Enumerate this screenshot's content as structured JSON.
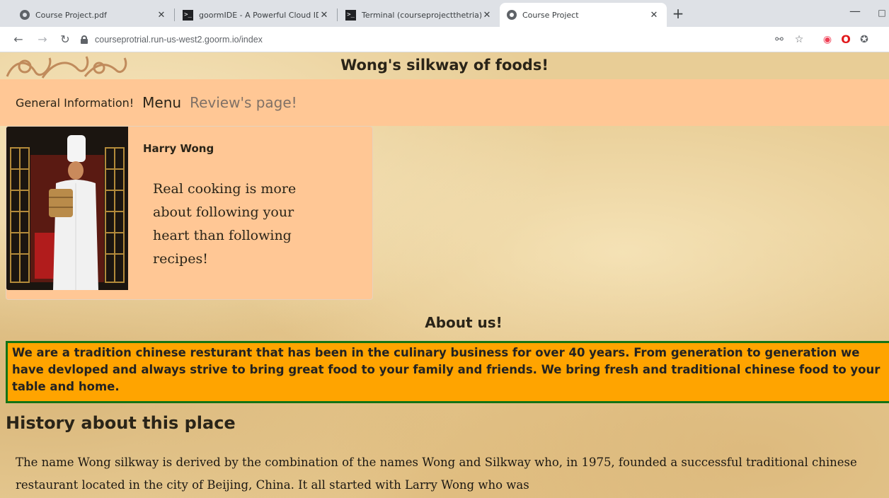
{
  "browser": {
    "tabs": [
      {
        "title": "Course Project.pdf",
        "icon": "globe-icon",
        "active": false
      },
      {
        "title": "goormIDE - A Powerful Cloud IDE",
        "icon": "terminal-icon",
        "active": false
      },
      {
        "title": "Terminal (courseprojectthetria) - goormIDE",
        "icon": "terminal-icon",
        "active": false
      },
      {
        "title": "Course Project",
        "icon": "globe-icon",
        "active": true
      }
    ],
    "tab_close_glyph": "✕",
    "new_tab_glyph": "+",
    "url": "courseprotrial.run-us-west2.goorm.io/index"
  },
  "site": {
    "title": "Wong's silkway of foods!",
    "nav": {
      "general": "General Information!",
      "menu": "Menu",
      "reviews": "Review's page!"
    },
    "chef": {
      "name": "Harry Wong",
      "quote": "Real cooking is more about following your heart than following recipes!"
    },
    "about": {
      "heading": "About us!",
      "text": "We are a tradition chinese resturant that has been in the culinary business for over 40 years. From generation to generation we have devloped and always strive to bring great food to your family and friends. We bring fresh and traditional chinese food to your table and home."
    },
    "history": {
      "heading": "History about this place",
      "text": "The name Wong silkway is derived by the combination of the names Wong and Silkway who, in 1975, founded a successful traditional chinese restaurant located in the city of Beijing, China. It all started with Larry Wong who was"
    }
  },
  "colors": {
    "navbar": "#ffc795",
    "about_box": "#ffa400",
    "about_border": "#137314",
    "parchment": "#e8cd96"
  }
}
